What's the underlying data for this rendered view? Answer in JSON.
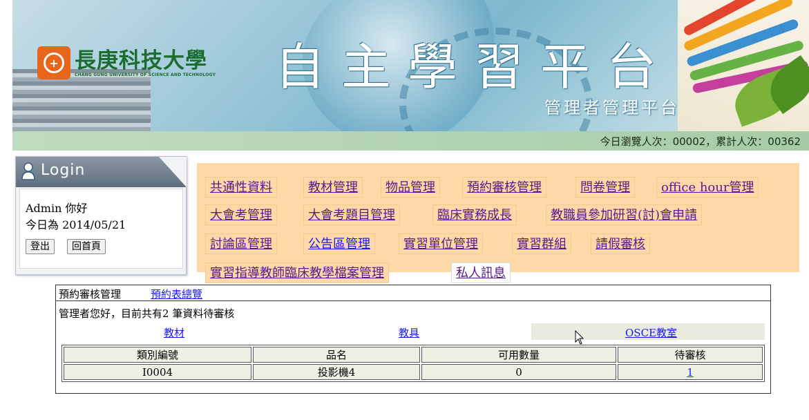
{
  "banner": {
    "logo_cn": "長庚科技大學",
    "logo_en": "CHANG GUNG UNIVERSITY OF SCIENCE AND TECHNOLOGY",
    "title": "自主學習平台",
    "subtitle": "管理者管理平台"
  },
  "counter": {
    "text": "今日瀏覽人次：00002，累計人次：00362"
  },
  "login": {
    "title": "Login",
    "greeting": "Admin 你好",
    "date": "今日為 2014/05/21",
    "logout_label": "登出",
    "home_label": "回首頁"
  },
  "menu": {
    "items": [
      "共通性資料",
      "教材管理",
      "物品管理",
      "預約審核管理",
      "問卷管理",
      "office hour管理",
      "大會考管理",
      "大會考題目管理",
      "臨床實務成長",
      "教職員參加研習(討)會申請",
      "討論區管理",
      "公告區管理",
      "實習單位管理",
      "實習群組",
      "請假審核",
      "實習指導教師臨床教學檔案管理",
      "私人訊息"
    ]
  },
  "content": {
    "title": "預約審核管理",
    "overview_link": "預約表總覽",
    "message": "管理者您好，目前共有2 筆資料待審核",
    "categories": [
      "教材",
      "教具",
      "OSCE教室"
    ],
    "table": {
      "headers": [
        "類別編號",
        "品名",
        "可用數量",
        "待審核"
      ],
      "rows": [
        [
          "I0004",
          "投影機4",
          "0",
          "1"
        ]
      ]
    }
  },
  "colors": {
    "menu_bg": "#fdd9a8",
    "counter_bar": "#b3d4b4",
    "link_blue": "#1a1aee",
    "link_visited": "#551a8b"
  }
}
